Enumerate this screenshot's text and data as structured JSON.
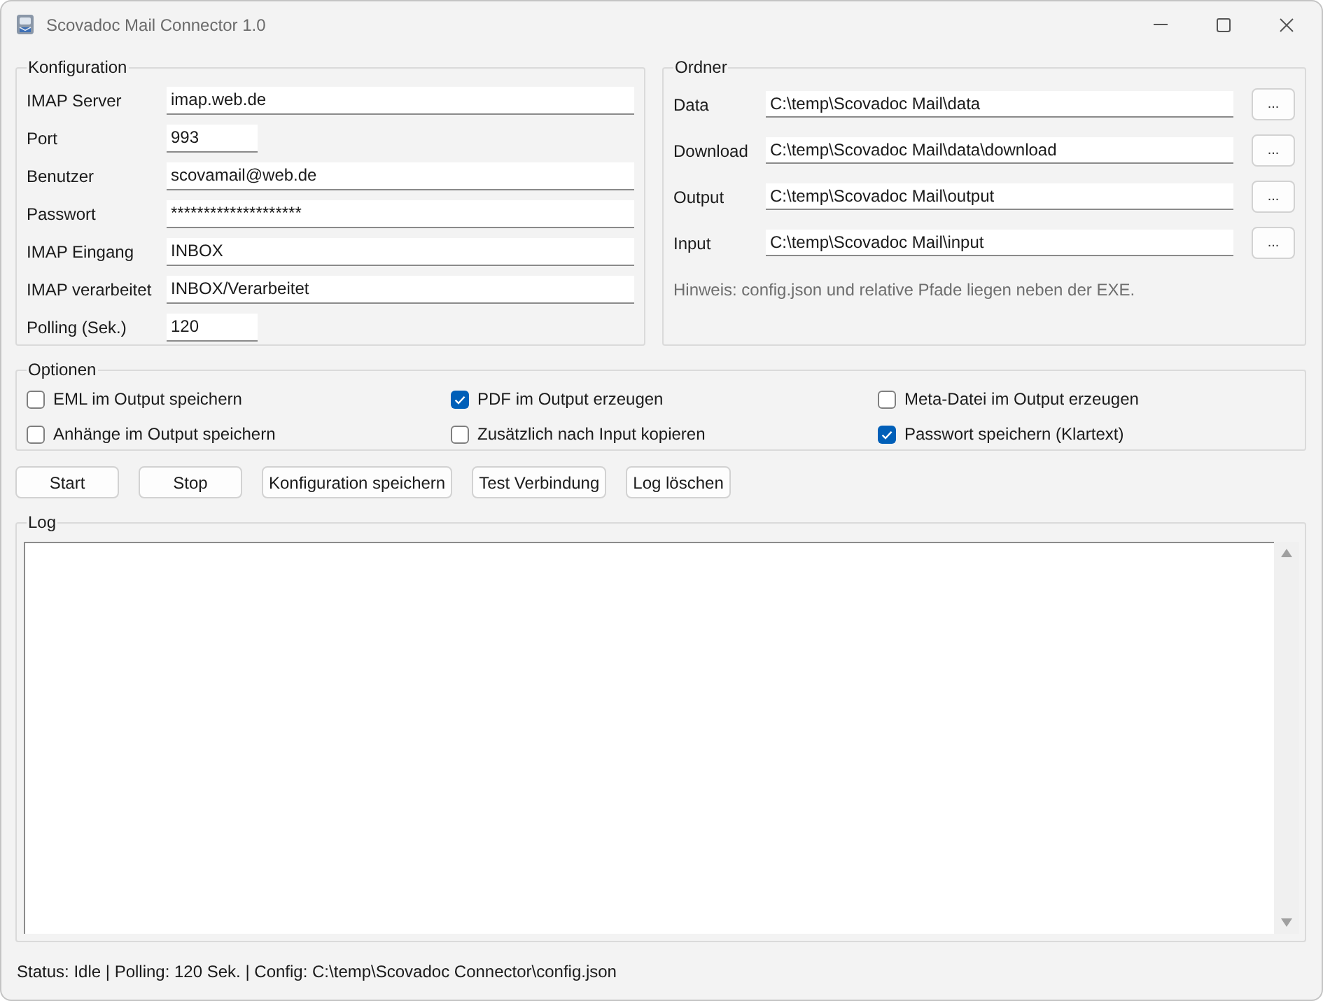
{
  "window": {
    "title": "Scovadoc Mail Connector 1.0"
  },
  "konfiguration": {
    "title": "Konfiguration",
    "fields": [
      {
        "label": "IMAP Server",
        "value": "imap.web.de",
        "kind": "text"
      },
      {
        "label": "Port",
        "value": "993",
        "kind": "number"
      },
      {
        "label": "Benutzer",
        "value": "scovamail@web.de",
        "kind": "text"
      },
      {
        "label": "Passwort",
        "value": "********************",
        "kind": "password"
      },
      {
        "label": "IMAP Eingang",
        "value": "INBOX",
        "kind": "text"
      },
      {
        "label": "IMAP verarbeitet",
        "value": "INBOX/Verarbeitet",
        "kind": "text"
      },
      {
        "label": "Polling (Sek.)",
        "value": "120",
        "kind": "number"
      }
    ]
  },
  "ordner": {
    "title": "Ordner",
    "fields": [
      {
        "label": "Data",
        "value": "C:\\temp\\Scovadoc Mail\\data",
        "button": "..."
      },
      {
        "label": "Download",
        "value": "C:\\temp\\Scovadoc Mail\\data\\download",
        "button": "..."
      },
      {
        "label": "Output",
        "value": "C:\\temp\\Scovadoc Mail\\output",
        "button": "..."
      },
      {
        "label": "Input",
        "value": "C:\\temp\\Scovadoc Mail\\input",
        "button": "..."
      }
    ],
    "hint": "Hinweis: config.json und relative Pfade liegen neben der EXE."
  },
  "optionen": {
    "title": "Optionen",
    "options": [
      {
        "label": "EML im Output speichern",
        "checked": false
      },
      {
        "label": "PDF im Output erzeugen",
        "checked": true
      },
      {
        "label": "Meta-Datei im Output erzeugen",
        "checked": false
      },
      {
        "label": "Anhänge im Output speichern",
        "checked": false
      },
      {
        "label": "Zusätzlich nach Input kopieren",
        "checked": false
      },
      {
        "label": "Passwort speichern (Klartext)",
        "checked": true
      }
    ]
  },
  "buttons": [
    "Start",
    "Stop",
    "Konfiguration speichern",
    "Test Verbindung",
    "Log löschen"
  ],
  "log": {
    "title": "Log"
  },
  "status_bar": {
    "text": "Status: Idle | Polling: 120 Sek. | Config: C:\\temp\\Scovadoc Connector\\config.json"
  }
}
